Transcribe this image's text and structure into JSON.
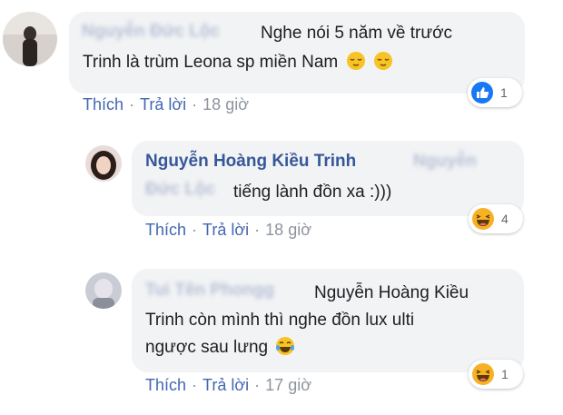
{
  "comments": [
    {
      "author": "Nguyễn Đức Lộc",
      "text_lines": [
        "Nghe nói 5 năm về trước",
        "Trinh là trùm Leona sp miền Nam"
      ],
      "emojis": [
        "relieved-face",
        "relieved-face"
      ],
      "actions": {
        "like": "Thích",
        "reply": "Trả lời",
        "time": "18 giờ"
      },
      "reaction": {
        "icon": "like-icon",
        "count": "1",
        "color": "#1877f2"
      }
    },
    {
      "author": "Nguyễn Hoàng Kiều Trinh",
      "mention": "Nguyễn Đức Lộc",
      "text": "tiếng lành đồn xa :)))",
      "actions": {
        "like": "Thích",
        "reply": "Trả lời",
        "time": "18 giờ"
      },
      "reaction": {
        "icon": "haha-icon",
        "count": "4",
        "color": "#f7b125"
      }
    },
    {
      "author": "Tui Tên Phongg",
      "text_lines": [
        "Nguyễn Hoàng Kiều",
        "Trinh còn mình thì nghe đồn lux ulti",
        "ngược sau lưng"
      ],
      "emojis": [
        "tears-of-joy-face"
      ],
      "actions": {
        "like": "Thích",
        "reply": "Trả lời",
        "time": "17 giờ"
      },
      "reaction": {
        "icon": "haha-icon",
        "count": "1",
        "color": "#f7b125"
      }
    }
  ]
}
